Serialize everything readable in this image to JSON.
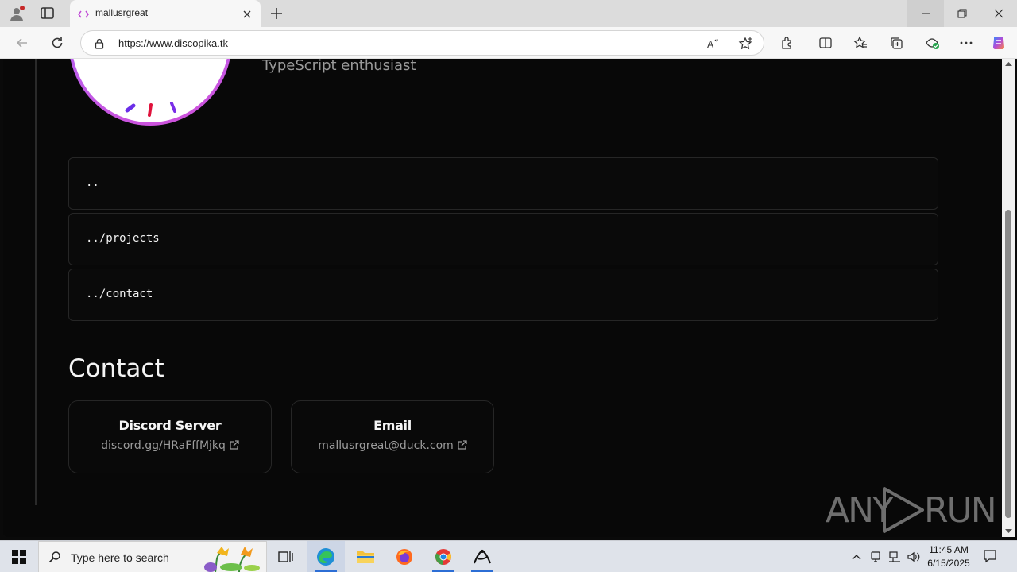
{
  "browser": {
    "tab_title": "mallusrgreat",
    "url": "https://www.discopika.tk"
  },
  "profile": {
    "tagline": "TypeScript enthusiast"
  },
  "nav_links": [
    {
      "label": ".."
    },
    {
      "label": "../projects"
    },
    {
      "label": "../contact"
    }
  ],
  "contact": {
    "title": "Contact",
    "cards": [
      {
        "title": "Discord Server",
        "link": "discord.gg/HRaFffMjkq"
      },
      {
        "title": "Email",
        "link": "mallusrgreat@duck.com"
      }
    ]
  },
  "watermark": {
    "left": "ANY",
    "right": "RUN"
  },
  "taskbar": {
    "search_placeholder": "Type here to search",
    "time": "11:45 AM",
    "date": "6/15/2025"
  },
  "colors": {
    "page_bg": "#080808",
    "avatar_ring_start": "#a86bff",
    "avatar_ring_end": "#d14fd8",
    "text_primary": "#f5f5f5",
    "text_muted": "#9c9c9c",
    "border": "#262626"
  }
}
